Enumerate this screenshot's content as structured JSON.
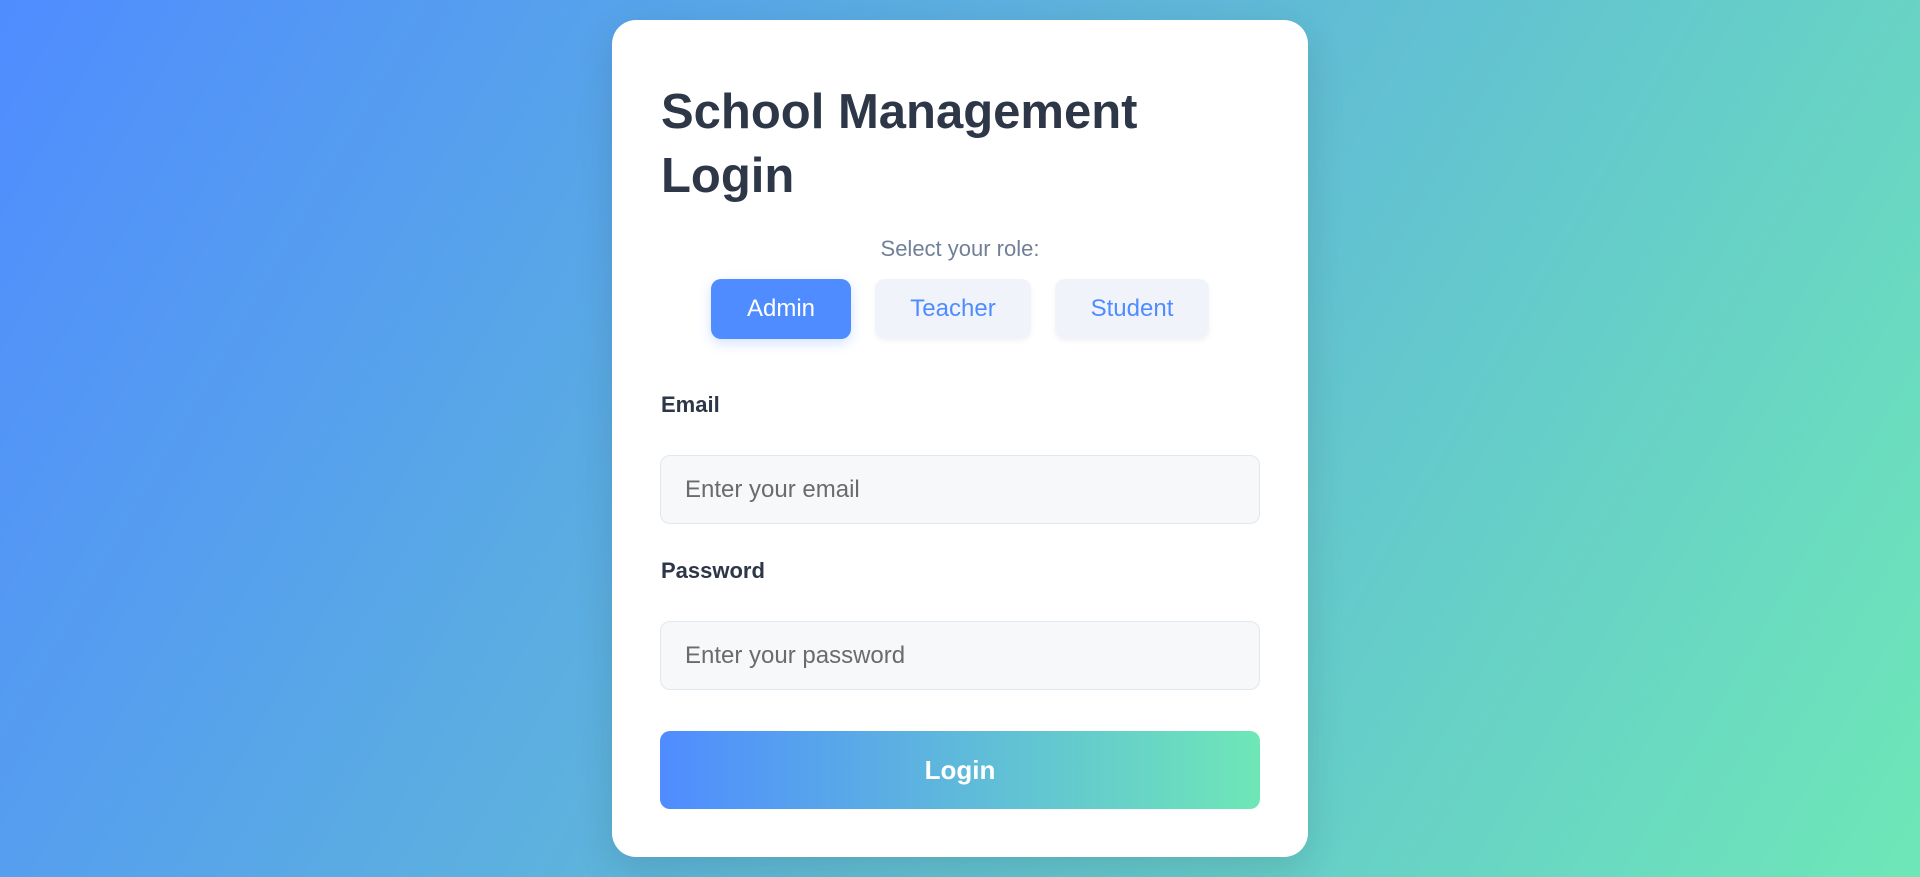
{
  "login": {
    "title": "School Management Login",
    "role_prompt": "Select your role:",
    "roles": [
      {
        "label": "Admin",
        "selected": true
      },
      {
        "label": "Teacher",
        "selected": false
      },
      {
        "label": "Student",
        "selected": false
      }
    ],
    "email_label": "Email",
    "email_placeholder": "Enter your email",
    "email_value": "",
    "password_label": "Password",
    "password_placeholder": "Enter your password",
    "password_value": "",
    "submit_label": "Login"
  },
  "colors": {
    "accent": "#4f8cff",
    "accent_end": "#6ee7b7",
    "title_text": "#2d3748",
    "muted_text": "#718096"
  }
}
